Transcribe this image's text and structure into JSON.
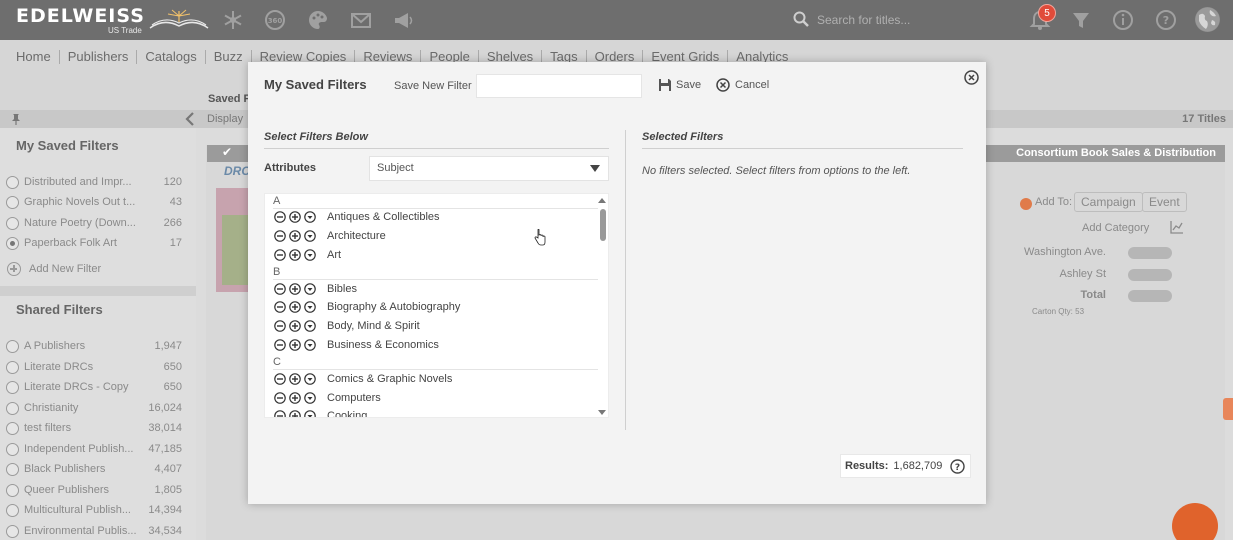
{
  "header": {
    "logo_text": "EDELWEISS",
    "logo_sub": "US Trade",
    "search_placeholder": "Search for titles...",
    "notification_count": "5",
    "icons": [
      "snowflake-icon",
      "360-icon",
      "palette-icon",
      "mail-icon",
      "megaphone-icon",
      "search-icon",
      "bell-icon",
      "filter-icon",
      "info-icon",
      "help-icon",
      "globe-icon"
    ]
  },
  "nav": {
    "items": [
      "Home",
      "Publishers",
      "Catalogs",
      "Buzz",
      "Review Copies",
      "Reviews",
      "People",
      "Shelves",
      "Tags",
      "Orders",
      "Event Grids",
      "Analytics"
    ],
    "saved_label": "Saved F",
    "display_label": "Display",
    "titles_count": "17 Titles"
  },
  "sidebar": {
    "my_saved_heading": "My Saved Filters",
    "my_saved": [
      {
        "name": "Distributed and Impr...",
        "count": "120",
        "selected": false
      },
      {
        "name": "Graphic Novels Out t...",
        "count": "43",
        "selected": false
      },
      {
        "name": "Nature Poetry (Down...",
        "count": "266",
        "selected": false
      },
      {
        "name": "Paperback Folk Art",
        "count": "17",
        "selected": true
      }
    ],
    "add_new_filter": "Add New Filter",
    "shared_heading": "Shared Filters",
    "shared": [
      {
        "name": "A Publishers",
        "count": "1,947"
      },
      {
        "name": "Literate DRCs",
        "count": "650"
      },
      {
        "name": "Literate DRCs - Copy",
        "count": "650"
      },
      {
        "name": "Christianity",
        "count": "16,024"
      },
      {
        "name": "test filters",
        "count": "38,014"
      },
      {
        "name": "Independent Publish...",
        "count": "47,185"
      },
      {
        "name": "Black Publishers",
        "count": "4,407"
      },
      {
        "name": "Queer Publishers",
        "count": "1,805"
      },
      {
        "name": "Multicultural Publish...",
        "count": "14,394"
      },
      {
        "name": "Environmental Publis...",
        "count": "34,534"
      }
    ]
  },
  "background": {
    "drc_label": "DRC",
    "distributor": "Consortium Book Sales & Distribution",
    "add_to_label": "Add To:",
    "campaign_button": "Campaign",
    "event_button": "Event",
    "add_category": "Add Category",
    "stores": [
      "Washington Ave.",
      "Ashley St"
    ],
    "total_label": "Total",
    "carton_qty": "Carton Qty: 53"
  },
  "modal": {
    "title": "My Saved Filters",
    "save_new_label": "Save New Filter",
    "save_new_value": "",
    "save_button": "Save",
    "cancel_button": "Cancel",
    "select_heading": "Select Filters Below",
    "selected_heading": "Selected Filters",
    "attributes_label": "Attributes",
    "attributes_value": "Subject",
    "no_selection_text": "No filters selected. Select filters from options to the left.",
    "groups": [
      {
        "letter": "A",
        "items": [
          "Antiques & Collectibles",
          "Architecture",
          "Art"
        ]
      },
      {
        "letter": "B",
        "items": [
          "Bibles",
          "Biography & Autobiography",
          "Body, Mind & Spirit",
          "Business & Economics"
        ]
      },
      {
        "letter": "C",
        "items": [
          "Comics & Graphic Novels",
          "Computers",
          "Cooking"
        ]
      }
    ],
    "results_label": "Results:",
    "results_value": "1,682,709"
  }
}
